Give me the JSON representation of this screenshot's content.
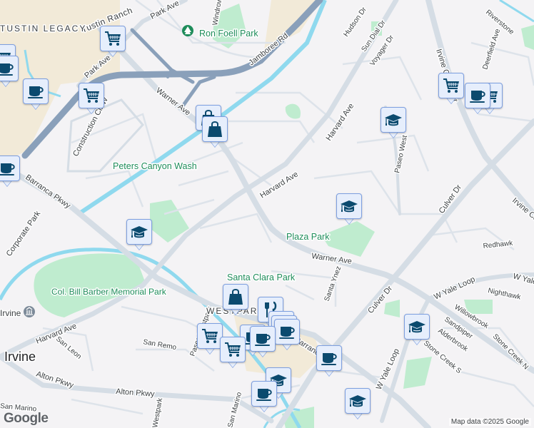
{
  "map": {
    "roads": {
      "warner_1": "Warner Ave",
      "warner_2": "Warner Ave",
      "harvard_1": "Harvard Ave",
      "harvard_2": "Harvard Ave",
      "harvard_3": "Harvard Ave",
      "barranca_1": "Barranca Pkwy",
      "barranca_2": "Barranca Pkwy",
      "alton_1": "Alton Pkwy",
      "alton_2": "Alton Pkwy",
      "jamboree": "Jamboree Rd",
      "park_ave_1": "Park Ave",
      "park_ave_2": "Park Ave",
      "tustin_ranch": "Tustin Ranch",
      "construction_cir": "Construction Cir W",
      "corporate_park": "Corporate Park",
      "culver_1": "Culver Dr",
      "culver_2": "Culver Dr",
      "irvine_center_1": "Irvine Center Dr",
      "irvine_center_2": "Irvine Center",
      "w_yale_1": "W Yale Loop",
      "w_yale_2": "W Yale Loop",
      "w_yale_3": "W Yale Loop",
      "hudson": "Hudson Dr",
      "sun_dial": "Sun Dial Dr",
      "voyager": "Voyager Dr",
      "riverstone": "Riverstone",
      "deerfield": "Deerfield Ave",
      "paseo_west": "Paseo West",
      "redhawk": "Redhawk",
      "nighthawk": "Nighthawk",
      "willowbrook": "Willowbrook",
      "sandpiper": "Sandpiper",
      "alderbrook": "Alderbrook",
      "stone_creek_s": "Stone Creek S",
      "stone_creek_n": "Stone Creek N",
      "santa_ynez": "Santa Ynez",
      "san_remo": "San Remo",
      "san_leon": "San Leon",
      "san_marino_1": "San Marino",
      "san_marino_2": "San Marino",
      "westpark": "Westpark",
      "windrow": "Windrow",
      "paseo_westpark": "Paseo Westpark"
    },
    "places": {
      "tustin_legacy": "TUSTIN LEGACY",
      "ron_foell_park": "Ron Foell Park",
      "peters_canyon_wash": "Peters Canyon Wash",
      "plaza_park": "Plaza Park",
      "santa_clara_park": "Santa Clara Park",
      "col_bill_barber": "Col. Bill Barber Memorial Park",
      "westpark": "WESTPARK",
      "irvine_city": "Irvine",
      "irvine_museum": "Irvine"
    },
    "attribution": "Map data ©2025 Google",
    "logo": "Google",
    "colors": {
      "background": "#f4f3f5",
      "park": "#bfeccf",
      "water": "#8fd9ee",
      "highway": "#8aa0ba",
      "road": "#d5dde5",
      "commercial": "#f2ead8",
      "marker_bg": "#e6eefc",
      "marker_icon": "#0b4a6e"
    }
  }
}
